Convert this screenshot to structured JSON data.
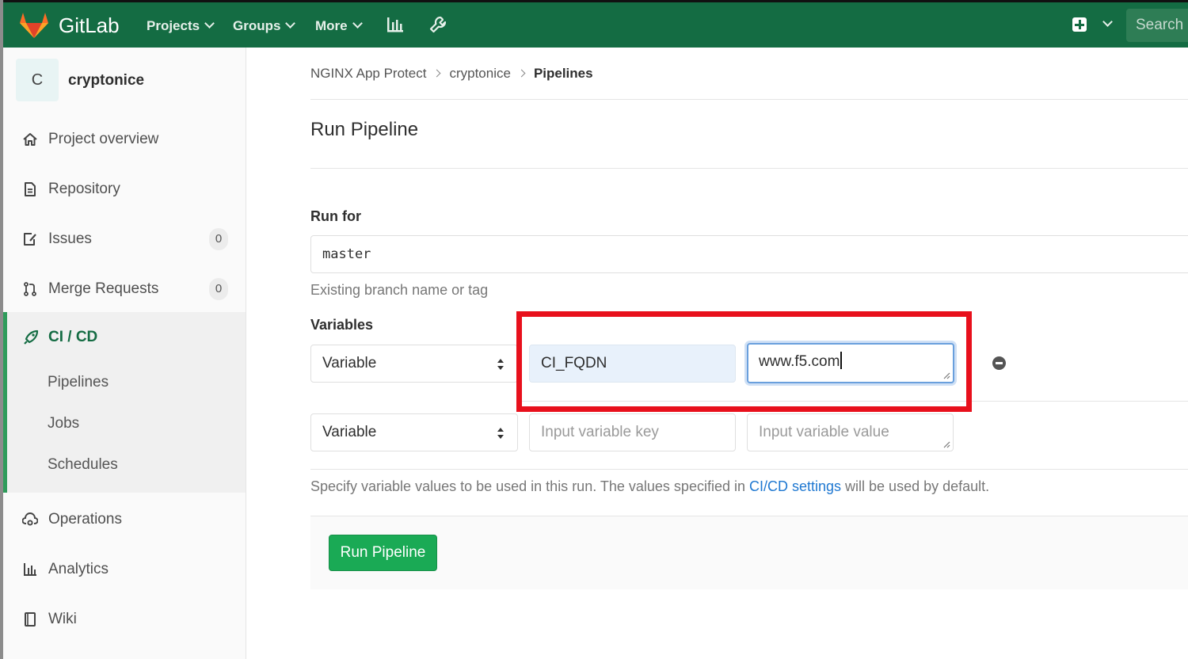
{
  "topnav": {
    "brand": "GitLab",
    "menu": {
      "projects": "Projects",
      "groups": "Groups",
      "more": "More"
    },
    "search_placeholder": "Search or jump to…",
    "brand_color": "#146c43"
  },
  "sidebar": {
    "project_initial": "C",
    "project_name": "cryptonice",
    "items": {
      "overview": "Project overview",
      "repository": "Repository",
      "issues": "Issues",
      "issues_count": "0",
      "merge_requests": "Merge Requests",
      "merge_requests_count": "0",
      "cicd": "CI / CD",
      "operations": "Operations",
      "analytics": "Analytics",
      "wiki": "Wiki"
    },
    "cicd_sub": {
      "pipelines": "Pipelines",
      "jobs": "Jobs",
      "schedules": "Schedules"
    }
  },
  "breadcrumb": {
    "group": "NGINX App Protect",
    "project": "cryptonice",
    "current": "Pipelines"
  },
  "page": {
    "title": "Run Pipeline"
  },
  "form": {
    "run_for_label": "Run for",
    "ref_value": "master",
    "ref_help": "Existing branch name or tag",
    "variables_label": "Variables",
    "rows": [
      {
        "type": "Variable",
        "key": "CI_FQDN",
        "value": "www.f5.com"
      },
      {
        "type": "Variable",
        "key_placeholder": "Input variable key",
        "value_placeholder": "Input variable value"
      }
    ],
    "help_before": "Specify variable values to be used in this run. The values specified in ",
    "help_link": "CI/CD settings",
    "help_after": " will be used by default.",
    "submit": "Run Pipeline"
  },
  "colors": {
    "accent_green": "#1aaa55",
    "highlight_red": "#e8101c",
    "link_blue": "#1f78d1"
  }
}
